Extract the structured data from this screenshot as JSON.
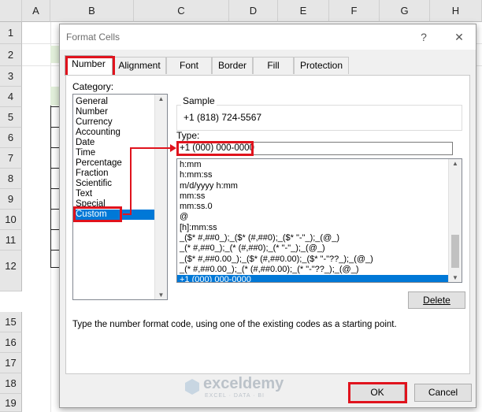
{
  "sheet": {
    "columns": [
      "A",
      "B",
      "C",
      "D",
      "E",
      "F",
      "G",
      "H"
    ],
    "rows": [
      "1",
      "2",
      "3",
      "4",
      "5",
      "6",
      "7",
      "8",
      "9",
      "10",
      "11",
      "12",
      "15",
      "16",
      "17",
      "18",
      "19"
    ]
  },
  "dialog": {
    "title": "Format Cells",
    "help": "?",
    "close": "✕",
    "tabs": [
      "Number",
      "Alignment",
      "Font",
      "Border",
      "Fill",
      "Protection"
    ],
    "category_label": "Category:",
    "categories": [
      "General",
      "Number",
      "Currency",
      "Accounting",
      "Date",
      "Time",
      "Percentage",
      "Fraction",
      "Scientific",
      "Text",
      "Special",
      "Custom"
    ],
    "selected_category": "Custom",
    "sample_label": "Sample",
    "sample_value": "+1 (818) 724-5567",
    "type_label": "Type:",
    "type_value": "+1 (000) 000-0000",
    "formats": [
      "h:mm",
      "h:mm:ss",
      "m/d/yyyy h:mm",
      "mm:ss",
      "mm:ss.0",
      "@",
      "[h]:mm:ss",
      "_($* #,##0_);_($* (#,##0);_($* \"-\"_);_(@_)",
      "_(* #,##0_);_(* (#,##0);_(* \"-\"_);_(@_)",
      "_($* #,##0.00_);_($* (#,##0.00);_($* \"-\"??_);_(@_)",
      "_(* #,##0.00_);_(* (#,##0.00);_(* \"-\"??_);_(@_)",
      "+1 (000) 000-0000"
    ],
    "delete_label": "Delete",
    "description": "Type the number format code, using one of the existing codes as a starting point.",
    "ok_label": "OK",
    "cancel_label": "Cancel",
    "watermark_brand": "exceldemy",
    "watermark_tagline": "EXCEL · DATA · BI"
  },
  "colors": {
    "accent": "#e0131d",
    "selection": "#0078d7"
  }
}
